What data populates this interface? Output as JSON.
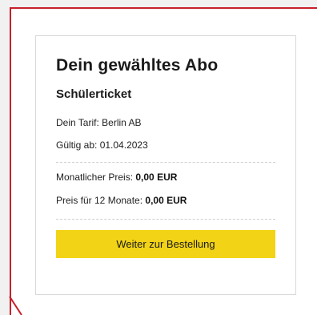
{
  "card": {
    "title": "Dein gewähltes Abo",
    "subtitle": "Schülerticket",
    "tarif_label": "Dein Tarif: ",
    "tarif_value": "Berlin AB",
    "valid_label": "Gültig ab: ",
    "valid_value": "01.04.2023",
    "monthly_label": "Monatlicher Preis: ",
    "monthly_value": "0,00 EUR",
    "year_label": "Preis für 12 Monate: ",
    "year_value": "0,00 EUR",
    "order_button_label": "Weiter zur Bestellung"
  },
  "colors": {
    "frame_accent": "#c8202a",
    "button_background": "#f2d316"
  }
}
